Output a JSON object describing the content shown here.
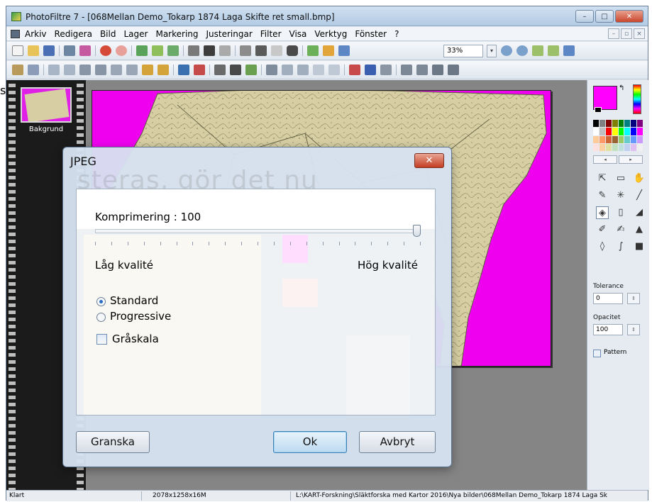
{
  "window": {
    "title": "PhotoFiltre 7 - [068Mellan Demo_Tokarp 1874 Laga Skifte ret small.bmp]",
    "buttons": {
      "minimize": "–",
      "maximize": "□",
      "close": "✕"
    }
  },
  "menu": {
    "items": [
      "Arkiv",
      "Redigera",
      "Bild",
      "Lager",
      "Markering",
      "Justeringar",
      "Filter",
      "Visa",
      "Verktyg",
      "Fönster",
      "?"
    ],
    "mdi_buttons": [
      "–",
      "▫",
      "×"
    ]
  },
  "toolbar": {
    "zoom_value": "33%",
    "zoom_arrow": "▾"
  },
  "layers": {
    "items": [
      {
        "label": "Bakgrund"
      }
    ]
  },
  "tool_panel": {
    "swap_icon": "↰",
    "palette_nav": [
      "◂",
      "▸"
    ],
    "tolerance_label": "Tolerance",
    "tolerance_value": "0",
    "opacity_label": "Opacitet",
    "opacity_value": "100",
    "spin_symbol": "⇕",
    "pattern_label": "Pattern",
    "palette_colors": [
      "#000000",
      "#808080",
      "#800000",
      "#808000",
      "#008000",
      "#008080",
      "#000080",
      "#800080",
      "#ffffff",
      "#c0c0c0",
      "#ff0000",
      "#ffff00",
      "#00ff00",
      "#00ffff",
      "#0000ff",
      "#ff00ff",
      "#ffcc99",
      "#ff9966",
      "#cc6633",
      "#996633",
      "#99cc66",
      "#66cccc",
      "#6699ff",
      "#cc99ff",
      "#ffe0e0",
      "#ffd0a0",
      "#e0e0a0",
      "#c0e0c0",
      "#c0e0e0",
      "#c0d0f0",
      "#e0c0f0",
      "#f0f0f0"
    ],
    "tools": [
      {
        "name": "pointer-tool-icon",
        "glyph": "⇱"
      },
      {
        "name": "selection-tool-icon",
        "glyph": "▭"
      },
      {
        "name": "hand-tool-icon",
        "glyph": "✋"
      },
      {
        "name": "eyedropper-tool-icon",
        "glyph": "✎"
      },
      {
        "name": "magic-wand-tool-icon",
        "glyph": "✳"
      },
      {
        "name": "line-tool-icon",
        "glyph": "╱"
      },
      {
        "name": "fill-tool-icon",
        "glyph": "◈"
      },
      {
        "name": "spray-tool-icon",
        "glyph": "▯"
      },
      {
        "name": "eraser-tool-icon",
        "glyph": "◢"
      },
      {
        "name": "brush-tool-icon",
        "glyph": "✐"
      },
      {
        "name": "smudge-tool-icon",
        "glyph": "✍"
      },
      {
        "name": "stamp-tool-icon",
        "glyph": "▲"
      },
      {
        "name": "blur-tool-icon",
        "glyph": "◊"
      },
      {
        "name": "finger-tool-icon",
        "glyph": "∫"
      },
      {
        "name": "clone-tool-icon",
        "glyph": "■"
      }
    ]
  },
  "status": {
    "state": "Klart",
    "dimensions": "2078x1258x16M",
    "path": "L:\\KART-Forskning\\Släktforska med Kartor 2016\\Nya bilder\\068Mellan Demo_Tokarp 1874 Laga Sk"
  },
  "side_fragment": "s",
  "dialog": {
    "title": "JPEG",
    "close_label": "✕",
    "watermark": "steras, gör det nu",
    "compression_label": "Komprimering : 100",
    "compression_value": 100,
    "low_label": "Låg kvalité",
    "high_label": "Hög kvalité",
    "options": [
      {
        "label": "Standard",
        "selected": true
      },
      {
        "label": "Progressive",
        "selected": false
      }
    ],
    "grayscale_label": "Gråskala",
    "grayscale_checked": false,
    "buttons": {
      "preview": "Granska",
      "ok": "Ok",
      "cancel": "Avbryt"
    }
  },
  "colors": {
    "canvas_background": "#ef00ef",
    "workspace": "#858585",
    "map_paper": "#d7cfa3",
    "accent": "#2b6cc4"
  }
}
